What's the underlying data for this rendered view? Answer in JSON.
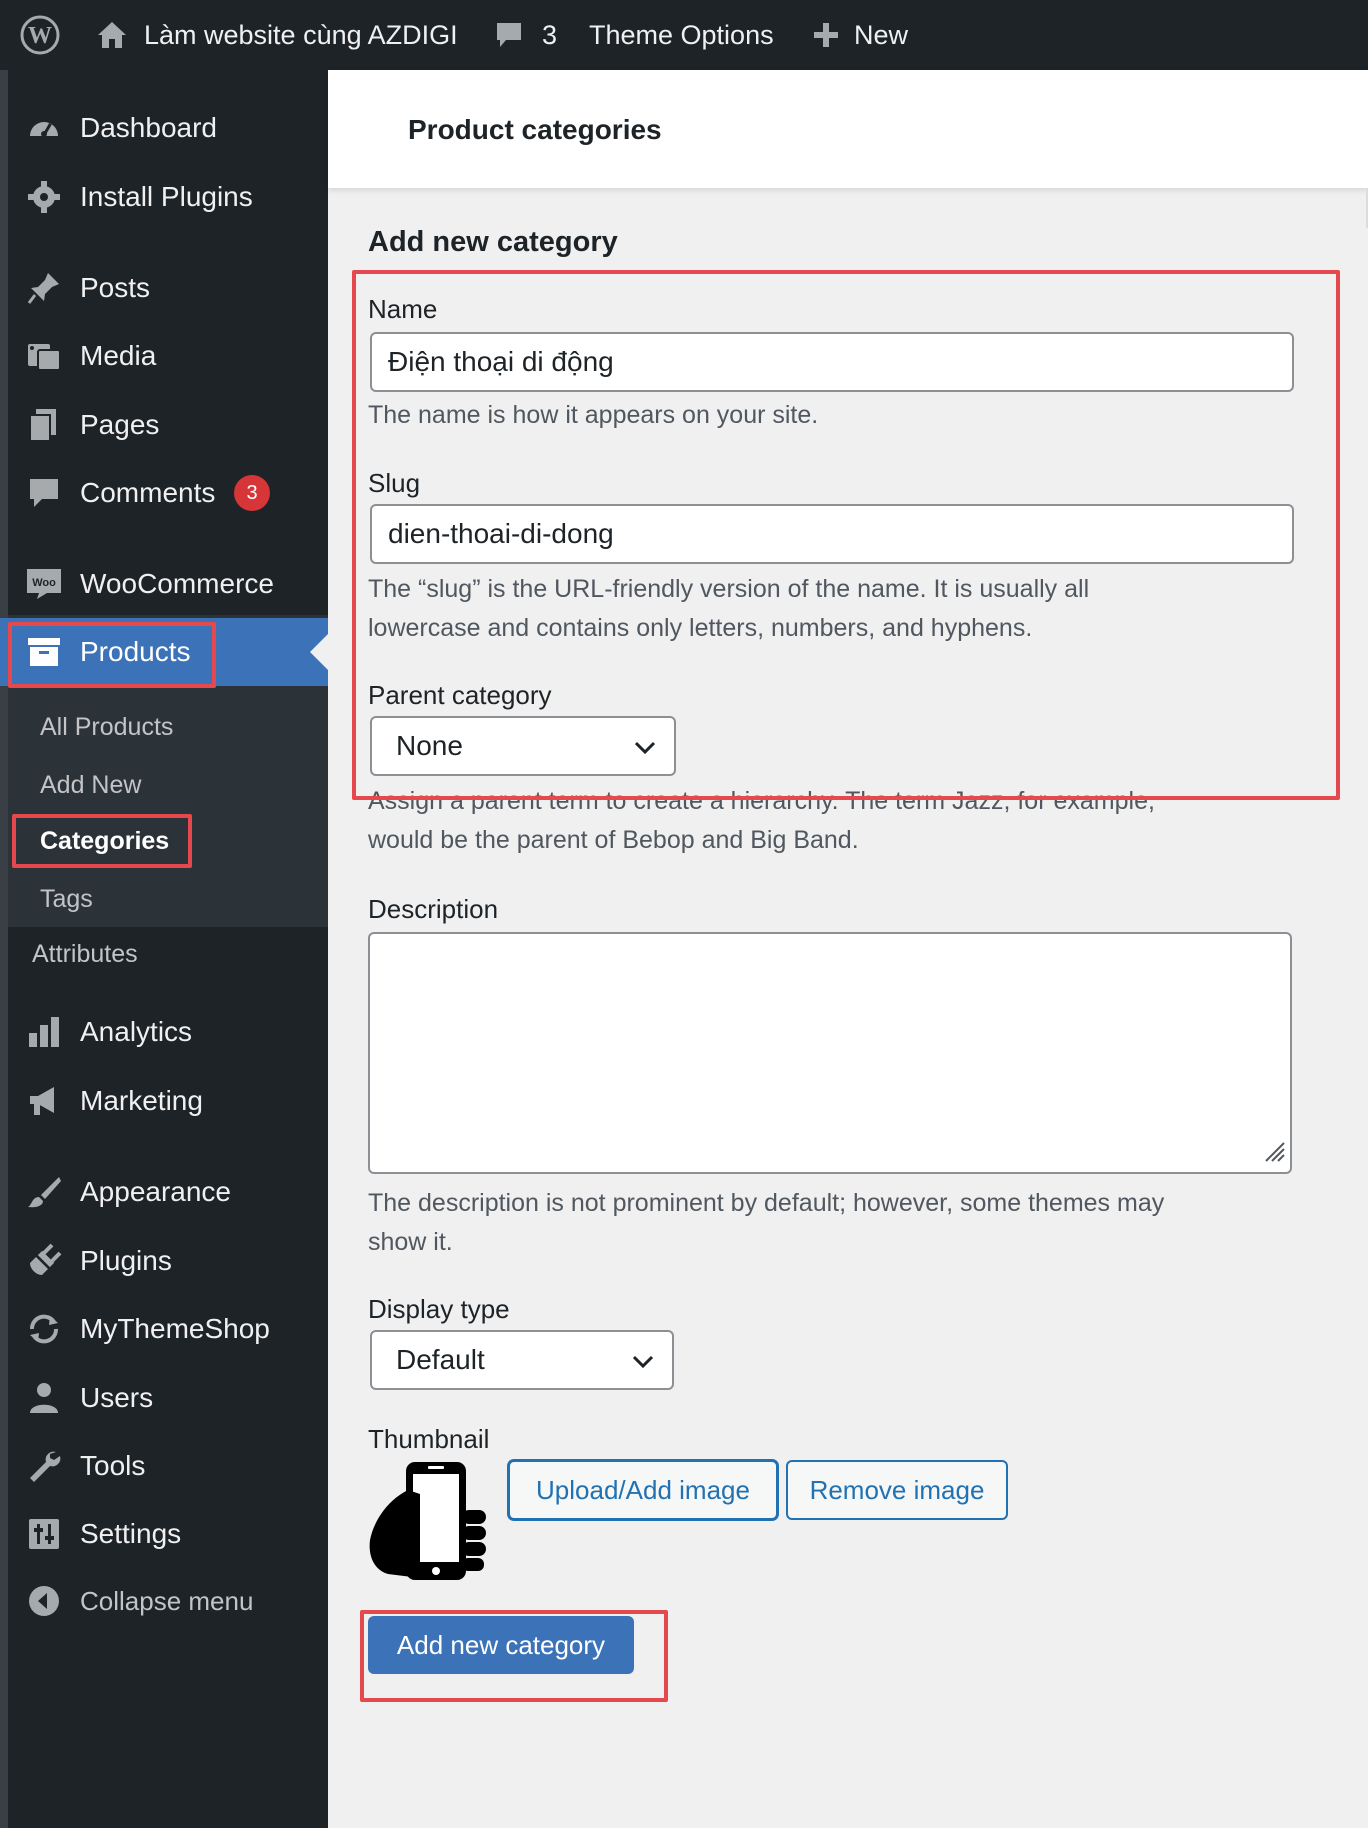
{
  "admin_bar": {
    "site_name": "Làm website cùng AZDIGI",
    "comments_count": "3",
    "theme_options": "Theme Options",
    "new_label": "New"
  },
  "sidebar": {
    "items": [
      {
        "label": "Dashboard",
        "icon": "dashboard-icon"
      },
      {
        "label": "Install Plugins",
        "icon": "gear-icon"
      },
      {
        "label": "Posts",
        "icon": "pin-icon"
      },
      {
        "label": "Media",
        "icon": "media-icon"
      },
      {
        "label": "Pages",
        "icon": "pages-icon"
      },
      {
        "label": "Comments",
        "icon": "comment-icon",
        "badge": "3"
      },
      {
        "label": "WooCommerce",
        "icon": "woo-icon"
      },
      {
        "label": "Products",
        "icon": "archive-icon"
      },
      {
        "label": "Analytics",
        "icon": "bar-chart-icon"
      },
      {
        "label": "Marketing",
        "icon": "megaphone-icon"
      },
      {
        "label": "Appearance",
        "icon": "brush-icon"
      },
      {
        "label": "Plugins",
        "icon": "plug-icon"
      },
      {
        "label": "MyThemeShop",
        "icon": "refresh-icon"
      },
      {
        "label": "Users",
        "icon": "user-icon"
      },
      {
        "label": "Tools",
        "icon": "wrench-icon"
      },
      {
        "label": "Settings",
        "icon": "sliders-icon"
      },
      {
        "label": "Collapse menu",
        "icon": "collapse-icon"
      }
    ],
    "submenu": [
      "All Products",
      "Add New",
      "Categories",
      "Tags",
      "Attributes"
    ]
  },
  "header": {
    "title": "Product categories"
  },
  "form": {
    "heading": "Add new category",
    "name_label": "Name",
    "name_value": "Điện thoại di động",
    "name_help": "The name is how it appears on your site.",
    "slug_label": "Slug",
    "slug_value": "dien-thoai-di-dong",
    "slug_help_1": "The “slug” is the URL-friendly version of the name. It is usually all",
    "slug_help_2": "lowercase and contains only letters, numbers, and hyphens.",
    "parent_label": "Parent category",
    "parent_value": "None",
    "parent_help_1": "Assign a parent term to create a hierarchy. The term Jazz, for example,",
    "parent_help_2": "would be the parent of Bebop and Big Band.",
    "description_label": "Description",
    "description_value": "",
    "description_help_1": "The description is not prominent by default; however, some themes may",
    "description_help_2": "show it.",
    "display_type_label": "Display type",
    "display_type_value": "Default",
    "thumbnail_label": "Thumbnail",
    "upload_button": "Upload/Add image",
    "remove_button": "Remove image",
    "submit_button": "Add new category"
  },
  "colors": {
    "admin_bg": "#1d2327",
    "accent": "#3c73b8",
    "highlight": "#e5484d",
    "badge": "#d63638",
    "link": "#2271b1"
  }
}
